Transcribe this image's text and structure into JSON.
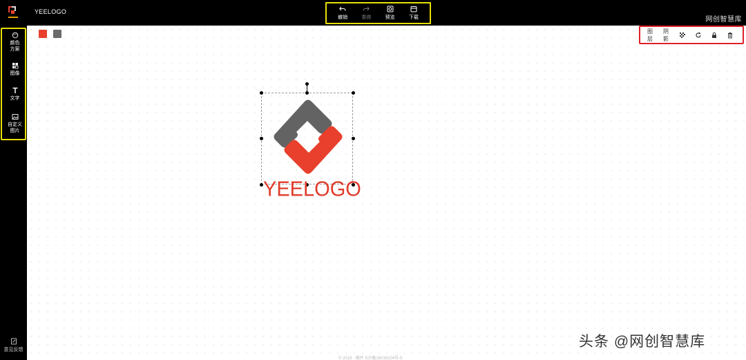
{
  "app": {
    "title": "YEELOGO",
    "top_right_label": "网创智慧库",
    "brand_colors": {
      "gray": "#636363",
      "red": "#e8402c",
      "yellow_highlight": "#e8e000",
      "red_highlight": "#e0202a"
    }
  },
  "toolbar": {
    "undo": "撤销",
    "redo": "重做",
    "preview": "预览",
    "download": "下载"
  },
  "sidebar": {
    "items": [
      {
        "label": "颜色方案",
        "icon": "palette-icon"
      },
      {
        "label": "图像",
        "icon": "grid-icon"
      },
      {
        "label": "文字",
        "icon": "text-icon"
      },
      {
        "label": "自定义图片",
        "icon": "image-icon"
      }
    ],
    "feedback": "意见反馈"
  },
  "swatches": [
    {
      "name": "red",
      "color": "#e8402c"
    },
    {
      "name": "gray",
      "color": "#6b6b6b"
    }
  ],
  "layer_toolbar": {
    "layer": "图层",
    "shadow": "阴影",
    "icons": [
      "transparency-icon",
      "rotate-icon",
      "lock-icon",
      "delete-icon"
    ]
  },
  "canvas": {
    "logo_text": "YEELOGO",
    "footer": "© 2018 - 图片 ICP备16016104号-5"
  },
  "watermark": "头条 @网创智慧库"
}
